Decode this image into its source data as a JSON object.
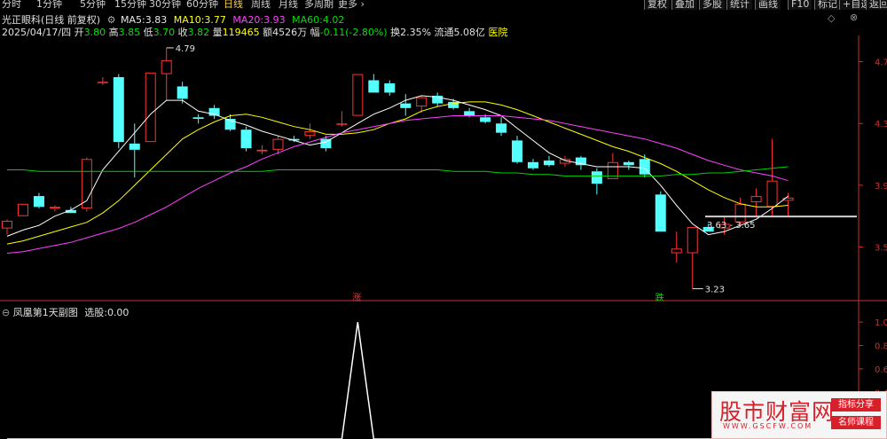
{
  "toolbar": {
    "periods": [
      "分时",
      "1分钟",
      "5分钟",
      "15分钟",
      "30分钟",
      "60分钟",
      "日线",
      "周线",
      "月线",
      "多周期",
      "更多"
    ],
    "active_period": "日线",
    "buttons": [
      "复权",
      "叠加",
      "多股",
      "统计",
      "画线",
      "F10",
      "标记",
      "+自选",
      "返回"
    ]
  },
  "main_info": {
    "title": "光正眼科(日线 前复权)",
    "ma5_label": "MA5:",
    "ma5_value": "3.83",
    "ma10_label": "MA10:",
    "ma10_value": "3.77",
    "ma20_label": "MA20:",
    "ma20_value": "3.93",
    "ma60_label": "MA60:",
    "ma60_value": "4.02"
  },
  "quote": {
    "date": "2025/04/17/四",
    "open_label": "开",
    "open": "3.80",
    "high_label": "高",
    "high": "3.85",
    "low_label": "低",
    "low": "3.70",
    "close_label": "收",
    "close": "3.82",
    "volume_label": "量",
    "volume": "119465",
    "amount_label": "额",
    "amount": "4526万",
    "change_label": "幅",
    "change": "-0.11(-2.80%)",
    "turnover_label": "换",
    "turnover": "2.35%",
    "float_label": "流通",
    "float_cap": "5.08亿",
    "industry": "医院"
  },
  "sub_info": {
    "title": "凤凰第1天副图",
    "signal_label": "选股:",
    "signal_value": "0.00"
  },
  "colors": {
    "up": "#ff3232",
    "down": "#54ffff",
    "ma5": "#ffffff",
    "ma10": "#ffff00",
    "ma20": "#ff40ff",
    "ma60": "#00d200",
    "grid": "#8b1010",
    "axis": "#c83030"
  },
  "chart_data": {
    "type": "candlestick",
    "price_axis": {
      "ticks": [
        "4.7",
        "4.3",
        "3.9",
        "3.5"
      ],
      "range": [
        3.17,
        4.87
      ]
    },
    "indicator_axis": {
      "ticks": [
        "1.0",
        "0.8",
        "0.6",
        "0.4"
      ],
      "range": [
        0,
        1.1
      ]
    },
    "candles": [
      {
        "o": 3.62,
        "h": 3.68,
        "l": 3.58,
        "c": 3.67
      },
      {
        "o": 3.7,
        "h": 3.78,
        "l": 3.7,
        "c": 3.78
      },
      {
        "o": 3.83,
        "h": 3.85,
        "l": 3.75,
        "c": 3.76
      },
      {
        "o": 3.75,
        "h": 3.77,
        "l": 3.73,
        "c": 3.76
      },
      {
        "o": 3.74,
        "h": 3.76,
        "l": 3.72,
        "c": 3.72
      },
      {
        "o": 3.75,
        "h": 4.08,
        "l": 3.73,
        "c": 4.07
      },
      {
        "o": 4.57,
        "h": 4.6,
        "l": 4.55,
        "c": 4.57
      },
      {
        "o": 4.6,
        "h": 4.62,
        "l": 4.14,
        "c": 4.18
      },
      {
        "o": 4.17,
        "h": 4.3,
        "l": 3.95,
        "c": 4.13
      },
      {
        "o": 4.18,
        "h": 4.63,
        "l": 4.18,
        "c": 4.63
      },
      {
        "o": 4.62,
        "h": 4.79,
        "l": 4.45,
        "c": 4.71
      },
      {
        "o": 4.54,
        "h": 4.57,
        "l": 4.43,
        "c": 4.46
      },
      {
        "o": 4.34,
        "h": 4.36,
        "l": 4.3,
        "c": 4.33
      },
      {
        "o": 4.4,
        "h": 4.42,
        "l": 4.33,
        "c": 4.35
      },
      {
        "o": 4.33,
        "h": 4.36,
        "l": 4.25,
        "c": 4.26
      },
      {
        "o": 4.26,
        "h": 4.28,
        "l": 4.12,
        "c": 4.14
      },
      {
        "o": 4.12,
        "h": 4.16,
        "l": 4.1,
        "c": 4.13
      },
      {
        "o": 4.13,
        "h": 4.22,
        "l": 4.1,
        "c": 4.2
      },
      {
        "o": 4.2,
        "h": 4.22,
        "l": 4.18,
        "c": 4.19
      },
      {
        "o": 4.22,
        "h": 4.3,
        "l": 4.2,
        "c": 4.25
      },
      {
        "o": 4.2,
        "h": 4.22,
        "l": 4.12,
        "c": 4.14
      },
      {
        "o": 4.3,
        "h": 4.38,
        "l": 4.28,
        "c": 4.3
      },
      {
        "o": 4.35,
        "h": 4.62,
        "l": 4.35,
        "c": 4.62
      },
      {
        "o": 4.58,
        "h": 4.62,
        "l": 4.5,
        "c": 4.5
      },
      {
        "o": 4.56,
        "h": 4.58,
        "l": 4.48,
        "c": 4.5
      },
      {
        "o": 4.43,
        "h": 4.49,
        "l": 4.35,
        "c": 4.4
      },
      {
        "o": 4.41,
        "h": 4.48,
        "l": 4.37,
        "c": 4.47
      },
      {
        "o": 4.48,
        "h": 4.5,
        "l": 4.41,
        "c": 4.43
      },
      {
        "o": 4.44,
        "h": 4.46,
        "l": 4.39,
        "c": 4.4
      },
      {
        "o": 4.38,
        "h": 4.4,
        "l": 4.34,
        "c": 4.35
      },
      {
        "o": 4.34,
        "h": 4.36,
        "l": 4.3,
        "c": 4.31
      },
      {
        "o": 4.3,
        "h": 4.34,
        "l": 4.22,
        "c": 4.24
      },
      {
        "o": 4.19,
        "h": 4.22,
        "l": 4.04,
        "c": 4.05
      },
      {
        "o": 4.05,
        "h": 4.07,
        "l": 4.0,
        "c": 4.01
      },
      {
        "o": 4.06,
        "h": 4.09,
        "l": 4.02,
        "c": 4.03
      },
      {
        "o": 4.04,
        "h": 4.09,
        "l": 4.02,
        "c": 4.07
      },
      {
        "o": 4.08,
        "h": 4.09,
        "l": 4.0,
        "c": 4.03
      },
      {
        "o": 3.99,
        "h": 4.01,
        "l": 3.84,
        "c": 3.91
      },
      {
        "o": 3.94,
        "h": 4.11,
        "l": 3.94,
        "c": 4.05
      },
      {
        "o": 4.05,
        "h": 4.06,
        "l": 4.0,
        "c": 4.03
      },
      {
        "o": 4.07,
        "h": 4.1,
        "l": 3.95,
        "c": 3.97
      },
      {
        "o": 3.84,
        "h": 3.86,
        "l": 3.6,
        "c": 3.6
      },
      {
        "o": 3.46,
        "h": 3.6,
        "l": 3.4,
        "c": 3.49
      },
      {
        "o": 3.46,
        "h": 3.63,
        "l": 3.23,
        "c": 3.63
      },
      {
        "o": 3.63,
        "h": 3.65,
        "l": 3.6,
        "c": 3.6
      },
      {
        "o": 3.62,
        "h": 3.7,
        "l": 3.58,
        "c": 3.65
      },
      {
        "o": 3.66,
        "h": 3.82,
        "l": 3.63,
        "c": 3.78
      },
      {
        "o": 3.79,
        "h": 3.88,
        "l": 3.7,
        "c": 3.83
      },
      {
        "o": 3.76,
        "h": 4.2,
        "l": 3.7,
        "c": 3.93
      },
      {
        "o": 3.8,
        "h": 3.85,
        "l": 3.7,
        "c": 3.82
      }
    ],
    "ma_series": [
      {
        "name": "MA5",
        "values": [
          3.57,
          3.61,
          3.64,
          3.7,
          3.74,
          3.8,
          4.0,
          4.12,
          4.24,
          4.36,
          4.45,
          4.45,
          4.38,
          4.36,
          4.32,
          4.29,
          4.25,
          4.22,
          4.19,
          4.16,
          4.18,
          4.24,
          4.3,
          4.36,
          4.4,
          4.45,
          4.48,
          4.47,
          4.45,
          4.42,
          4.39,
          4.35,
          4.27,
          4.19,
          4.11,
          4.06,
          4.04,
          4.02,
          4.02,
          4.02,
          4.01,
          3.9,
          3.77,
          3.65,
          3.58,
          3.6,
          3.64,
          3.68,
          3.75,
          3.83
        ]
      },
      {
        "name": "MA10",
        "values": [
          3.52,
          3.54,
          3.57,
          3.6,
          3.63,
          3.66,
          3.72,
          3.8,
          3.9,
          4.0,
          4.1,
          4.2,
          4.26,
          4.31,
          4.35,
          4.36,
          4.34,
          4.31,
          4.28,
          4.26,
          4.23,
          4.23,
          4.24,
          4.26,
          4.3,
          4.33,
          4.38,
          4.41,
          4.43,
          4.44,
          4.44,
          4.42,
          4.39,
          4.35,
          4.31,
          4.27,
          4.23,
          4.19,
          4.15,
          4.12,
          4.08,
          4.04,
          3.99,
          3.93,
          3.87,
          3.82,
          3.78,
          3.76,
          3.76,
          3.77
        ]
      },
      {
        "name": "MA20",
        "values": [
          3.46,
          3.47,
          3.49,
          3.51,
          3.53,
          3.56,
          3.59,
          3.62,
          3.66,
          3.71,
          3.76,
          3.82,
          3.88,
          3.93,
          3.98,
          4.02,
          4.07,
          4.11,
          4.15,
          4.18,
          4.21,
          4.24,
          4.26,
          4.28,
          4.3,
          4.32,
          4.33,
          4.34,
          4.35,
          4.35,
          4.35,
          4.35,
          4.34,
          4.33,
          4.32,
          4.3,
          4.28,
          4.26,
          4.24,
          4.22,
          4.2,
          4.17,
          4.14,
          4.1,
          4.06,
          4.03,
          4.0,
          3.98,
          3.96,
          3.93
        ]
      },
      {
        "name": "MA60",
        "values": [
          4.0,
          4.0,
          3.99,
          3.99,
          3.99,
          3.99,
          3.99,
          3.99,
          3.99,
          3.99,
          3.99,
          3.99,
          3.99,
          3.99,
          3.99,
          3.99,
          3.99,
          4.0,
          4.0,
          4.0,
          4.0,
          4.0,
          4.0,
          4.0,
          4.0,
          4.0,
          4.0,
          4.0,
          3.99,
          3.99,
          3.99,
          3.98,
          3.98,
          3.97,
          3.97,
          3.96,
          3.96,
          3.96,
          3.96,
          3.96,
          3.96,
          3.96,
          3.97,
          3.97,
          3.98,
          3.98,
          3.99,
          4.0,
          4.01,
          4.02
        ]
      }
    ],
    "annotations": {
      "high_label": "4.79",
      "low_label": "3.23",
      "range_label": "3.63 - 3.65",
      "up_tag": "涨",
      "down_tag": "跌"
    },
    "indicator": {
      "name": "选股",
      "values": [
        0,
        0,
        0,
        0,
        0,
        0,
        0,
        0,
        0,
        0,
        0,
        0,
        0,
        0,
        0,
        0,
        0,
        0,
        0,
        0,
        0,
        0,
        1,
        0,
        0,
        0,
        0,
        0,
        0,
        0,
        0,
        0,
        0,
        0,
        0,
        0,
        0,
        0,
        0,
        0,
        0,
        0,
        0,
        0,
        0,
        0,
        0,
        0,
        0,
        0
      ]
    }
  },
  "watermark": {
    "title": "股市财富网",
    "url": "WWW.GSCFW.COM",
    "tag1": "指标分享",
    "tag2": "名师课程"
  }
}
